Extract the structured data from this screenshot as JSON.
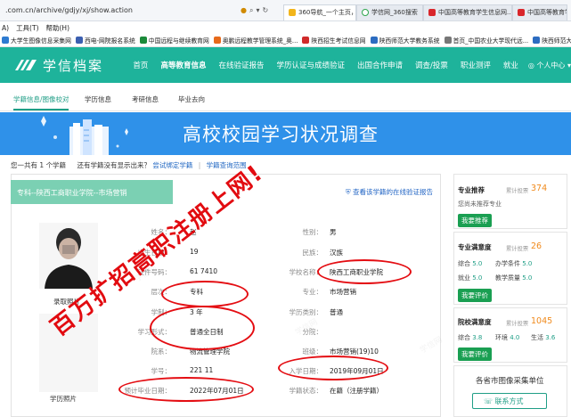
{
  "browser": {
    "url": ".com.cn/archive/gdjy/xj/show.action",
    "tabs": [
      {
        "label": "360导航_一个主页，整个..."
      },
      {
        "label": "学信网_360搜索"
      },
      {
        "label": "中国高等教育学生信息网..."
      },
      {
        "label": "中国高等教育学生"
      }
    ],
    "menu": [
      "A)",
      "工具(T)",
      "帮助(H)"
    ],
    "favorites": [
      "大学生图像信息采集网",
      "西电-网院报名系统",
      "中国远程与继续教育网",
      "奥鹏远程教学管理系统_奥...",
      "陕西招生考试信息网",
      "陕西师范大学教务系统",
      "首页_中国农业大学现代远...",
      "陕西师范大学"
    ]
  },
  "site": {
    "logo_text": "学信档案",
    "nav": [
      "首页",
      "高等教育信息",
      "在线验证报告",
      "学历认证与成绩验证",
      "出国合作申请",
      "调查/投票",
      "职业测评",
      "就业"
    ],
    "user_menu": "个人中心 ▾",
    "subnav": [
      "学籍信息/图像校对",
      "学历信息",
      "考研信息",
      "毕业去向"
    ]
  },
  "banner": {
    "title": "高校校园学习状况调查"
  },
  "summary": {
    "text_a": "您一共有",
    "count": "1",
    "text_b": "个学籍",
    "text_c": "还有学籍没有显示出来？",
    "link_bind": "尝试绑定学籍",
    "sep": "|",
    "link_query": "学籍查询范围"
  },
  "record": {
    "header": "专科--陕西工商职业学院--市场营销",
    "verify_link": "查看该学籍的在线验证报告",
    "photo1_label": "录取照片",
    "photo2_label": "学历照片",
    "left_fields": [
      {
        "label": "姓名：",
        "value": "赵"
      },
      {
        "label": "出生日期：",
        "value": "19"
      },
      {
        "label": "证件号码：",
        "value": "61                7410"
      },
      {
        "label": "层次：",
        "value": "专科"
      },
      {
        "label": "学制：",
        "value": "3 年"
      },
      {
        "label": "学习形式：",
        "value": "普通全日制"
      },
      {
        "label": "院系：",
        "value": "物流管理学院"
      },
      {
        "label": "学号：",
        "value": "221             11"
      },
      {
        "label": "预计毕业日期：",
        "value": "2022年07月01日"
      }
    ],
    "right_fields": [
      {
        "label": "性别：",
        "value": "男"
      },
      {
        "label": "民族：",
        "value": "汉族"
      },
      {
        "label": "学校名称：",
        "value": "陕西工商职业学院"
      },
      {
        "label": "专业：",
        "value": "市场营销"
      },
      {
        "label": "学历类别：",
        "value": "普通"
      },
      {
        "label": "分院：",
        "value": ""
      },
      {
        "label": "班级：",
        "value": "市场营销(19)10"
      },
      {
        "label": "入学日期：",
        "value": "2019年09月01日"
      },
      {
        "label": "学籍状态：",
        "value": "在籍（注册学籍）"
      }
    ]
  },
  "sidebar": {
    "recommend": {
      "title": "专业推荐",
      "count_label": "累计投票",
      "count": "374",
      "note": "您尚未推荐专业",
      "button": "我要推荐"
    },
    "major_satisfaction": {
      "title": "专业满意度",
      "count_label": "累计投票",
      "count": "26",
      "scores": [
        {
          "label": "综合",
          "value": "5.0"
        },
        {
          "label": "办学条件",
          "value": "5.0"
        },
        {
          "label": "就业",
          "value": "5.0"
        },
        {
          "label": "教学质量",
          "value": "5.0"
        }
      ],
      "button": "我要评价"
    },
    "school_satisfaction": {
      "title": "院校满意度",
      "count_label": "累计投票",
      "count": "1045",
      "scores": [
        {
          "label": "综合",
          "value": "3.8"
        },
        {
          "label": "环境",
          "value": "4.0"
        },
        {
          "label": "生活",
          "value": "3.6"
        }
      ],
      "button": "我要评价"
    },
    "collection": {
      "title": "各省市图像采集单位",
      "button": "联系方式"
    }
  },
  "overlay": {
    "watermark": "百万扩招高职注册上网!"
  },
  "colors": {
    "brand": "#1eb39b",
    "banner": "#2f91e9",
    "accent_orange": "#f08a1c",
    "button_green": "#1a9f52",
    "annotation_red": "#e40d12"
  }
}
